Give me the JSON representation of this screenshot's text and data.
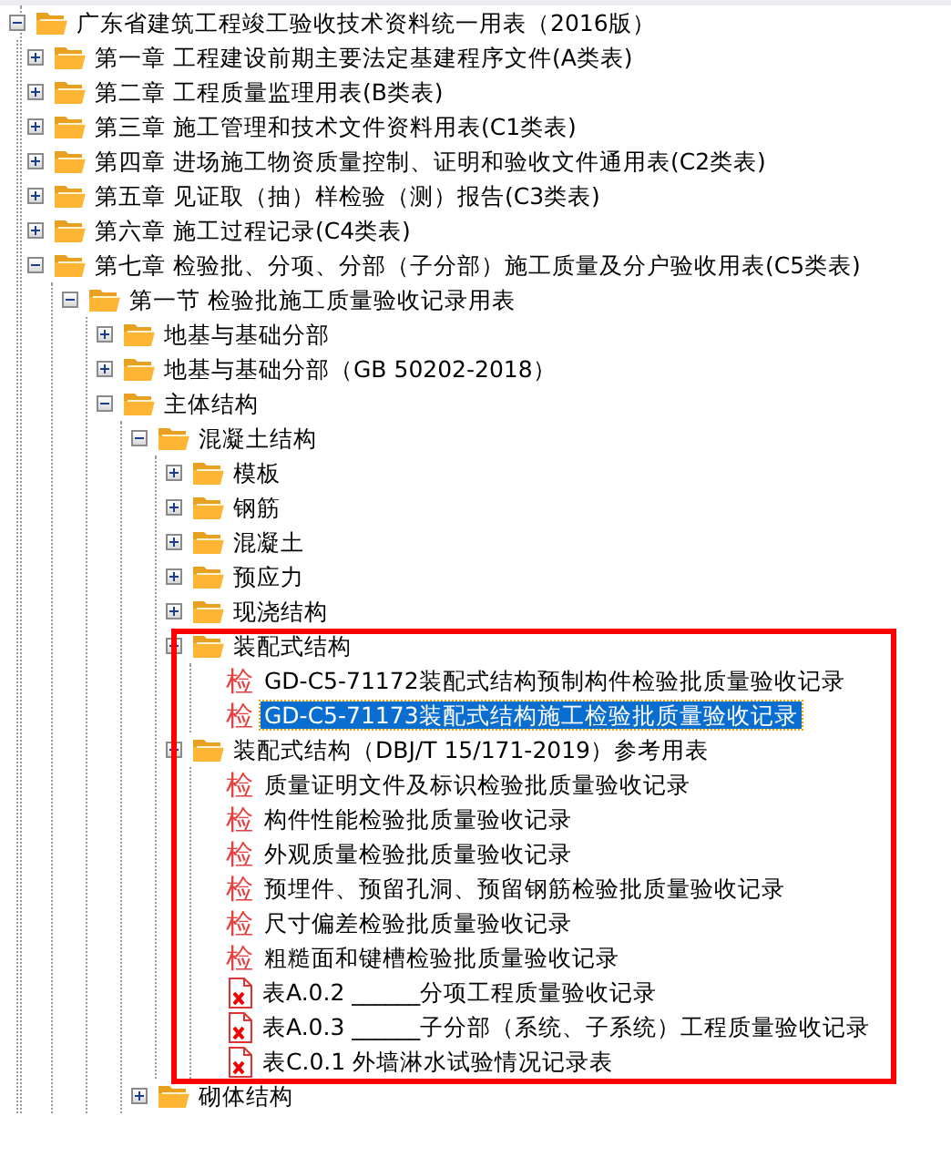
{
  "tree": [
    {
      "kind": "folder",
      "label": "广东省建筑工程竣工验收技术资料统一用表（2016版）",
      "expanded": true,
      "selected": false,
      "children": [
        {
          "kind": "folder",
          "label": "第一章 工程建设前期主要法定基建程序文件(A类表)",
          "expanded": false,
          "selected": false
        },
        {
          "kind": "folder",
          "label": "第二章 工程质量监理用表(B类表)",
          "expanded": false,
          "selected": false
        },
        {
          "kind": "folder",
          "label": "第三章 施工管理和技术文件资料用表(C1类表)",
          "expanded": false,
          "selected": false
        },
        {
          "kind": "folder",
          "label": "第四章 进场施工物资质量控制、证明和验收文件通用表(C2类表)",
          "expanded": false,
          "selected": false
        },
        {
          "kind": "folder",
          "label": "第五章  见证取（抽）样检验（测）报告(C3类表)",
          "expanded": false,
          "selected": false
        },
        {
          "kind": "folder",
          "label": "第六章 施工过程记录(C4类表)",
          "expanded": false,
          "selected": false
        },
        {
          "kind": "folder",
          "label": "第七章 检验批、分项、分部（子分部）施工质量及分户验收用表(C5类表)",
          "expanded": true,
          "selected": false,
          "children": [
            {
              "kind": "folder",
              "label": "第一节 检验批施工质量验收记录用表",
              "expanded": true,
              "selected": false,
              "children": [
                {
                  "kind": "folder",
                  "label": "地基与基础分部",
                  "expanded": false,
                  "selected": false
                },
                {
                  "kind": "folder",
                  "label": "地基与基础分部（GB 50202-2018）",
                  "expanded": false,
                  "selected": false
                },
                {
                  "kind": "folder",
                  "label": "主体结构",
                  "expanded": true,
                  "selected": false,
                  "children": [
                    {
                      "kind": "folder",
                      "label": "混凝土结构",
                      "expanded": true,
                      "selected": false,
                      "children": [
                        {
                          "kind": "folder",
                          "label": "模板",
                          "expanded": false,
                          "selected": false
                        },
                        {
                          "kind": "folder",
                          "label": "钢筋",
                          "expanded": false,
                          "selected": false
                        },
                        {
                          "kind": "folder",
                          "label": "混凝土",
                          "expanded": false,
                          "selected": false
                        },
                        {
                          "kind": "folder",
                          "label": "预应力",
                          "expanded": false,
                          "selected": false
                        },
                        {
                          "kind": "folder",
                          "label": "现浇结构",
                          "expanded": false,
                          "selected": false
                        },
                        {
                          "kind": "folder",
                          "label": "装配式结构",
                          "expanded": true,
                          "selected": false,
                          "children": [
                            {
                              "kind": "check",
                              "glyph": "检",
                              "label": "GD-C5-71172装配式结构预制构件检验批质量验收记录",
                              "selected": false
                            },
                            {
                              "kind": "check",
                              "glyph": "检",
                              "label": "GD-C5-71173装配式结构施工检验批质量验收记录",
                              "selected": true
                            }
                          ]
                        },
                        {
                          "kind": "folder",
                          "label": "装配式结构（DBJ/T 15/171-2019）参考用表",
                          "expanded": true,
                          "selected": false,
                          "children": [
                            {
                              "kind": "check",
                              "glyph": "检",
                              "label": "质量证明文件及标识检验批质量验收记录",
                              "selected": false
                            },
                            {
                              "kind": "check",
                              "glyph": "检",
                              "label": "构件性能检验批质量验收记录",
                              "selected": false
                            },
                            {
                              "kind": "check",
                              "glyph": "检",
                              "label": "外观质量检验批质量验收记录",
                              "selected": false
                            },
                            {
                              "kind": "check",
                              "glyph": "检",
                              "label": "预埋件、预留孔洞、预留钢筋检验批质量验收记录",
                              "selected": false
                            },
                            {
                              "kind": "check",
                              "glyph": "检",
                              "label": "尺寸偏差检验批质量验收记录",
                              "selected": false
                            },
                            {
                              "kind": "check",
                              "glyph": "检",
                              "label": "粗糙面和键槽检验批质量验收记录",
                              "selected": false
                            },
                            {
                              "kind": "file",
                              "label": "表A.0.2 ______分项工程质量验收记录",
                              "selected": false
                            },
                            {
                              "kind": "file",
                              "label": "表A.0.3 ______子分部（系统、子系统）工程质量验收记录",
                              "selected": false
                            },
                            {
                              "kind": "file",
                              "label": "表C.0.1 外墙淋水试验情况记录表",
                              "selected": false
                            }
                          ]
                        }
                      ]
                    },
                    {
                      "kind": "folder",
                      "label": "砌体结构",
                      "expanded": false,
                      "selected": false
                    }
                  ]
                }
              ]
            }
          ]
        }
      ]
    }
  ],
  "annotation": {
    "kind": "frame"
  }
}
